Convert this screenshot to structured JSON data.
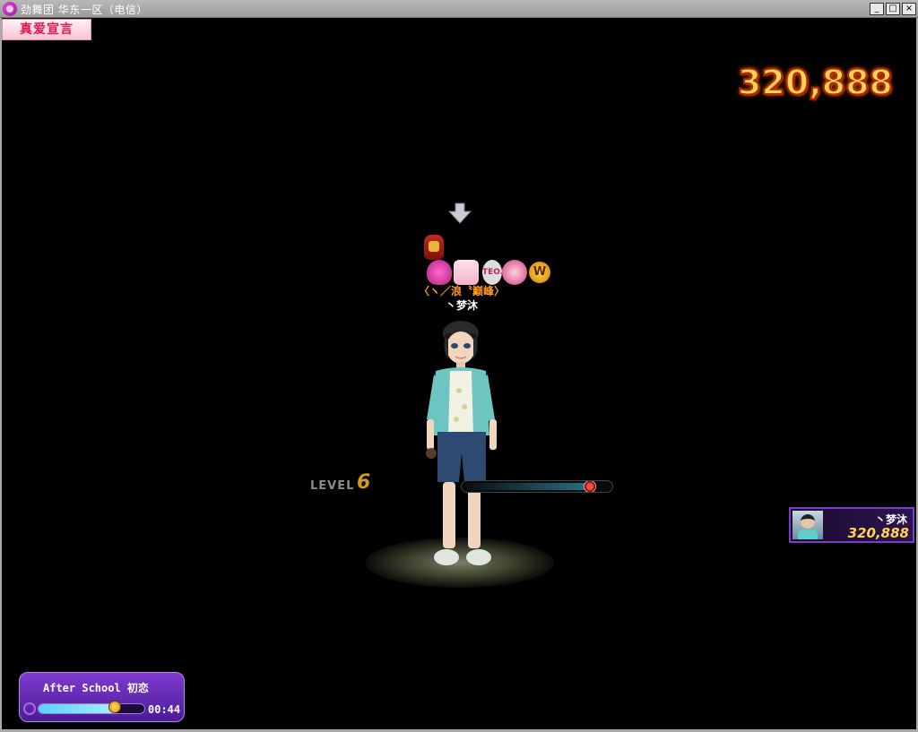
{
  "window": {
    "title": "劲舞团 华东一区（电信）",
    "controls": {
      "minimize": "_",
      "maximize": "□",
      "close": "×"
    }
  },
  "hud": {
    "love_button_label": "真爱宣言",
    "score": "320,888",
    "arrow_icon": "down-arrow-icon"
  },
  "player": {
    "guild": "〈ヽ／浪〝巅峰〉",
    "name": "丶梦沐",
    "badge_logo_text": "ТЕОЛ",
    "badge_w_text": "W",
    "level_label": "LEVEL",
    "level": "6",
    "exp_fraction": 0.85
  },
  "ranking": {
    "name": "丶梦沐",
    "score": "320,888"
  },
  "music": {
    "title": "After School 初恋",
    "progress_fraction": 0.72,
    "time": "00:44"
  },
  "colors": {
    "accent_purple": "#7e3ad0",
    "score_orange": "#ffd25a",
    "guild_orange": "#ff9a1a",
    "level_gold": "#d79a18"
  }
}
